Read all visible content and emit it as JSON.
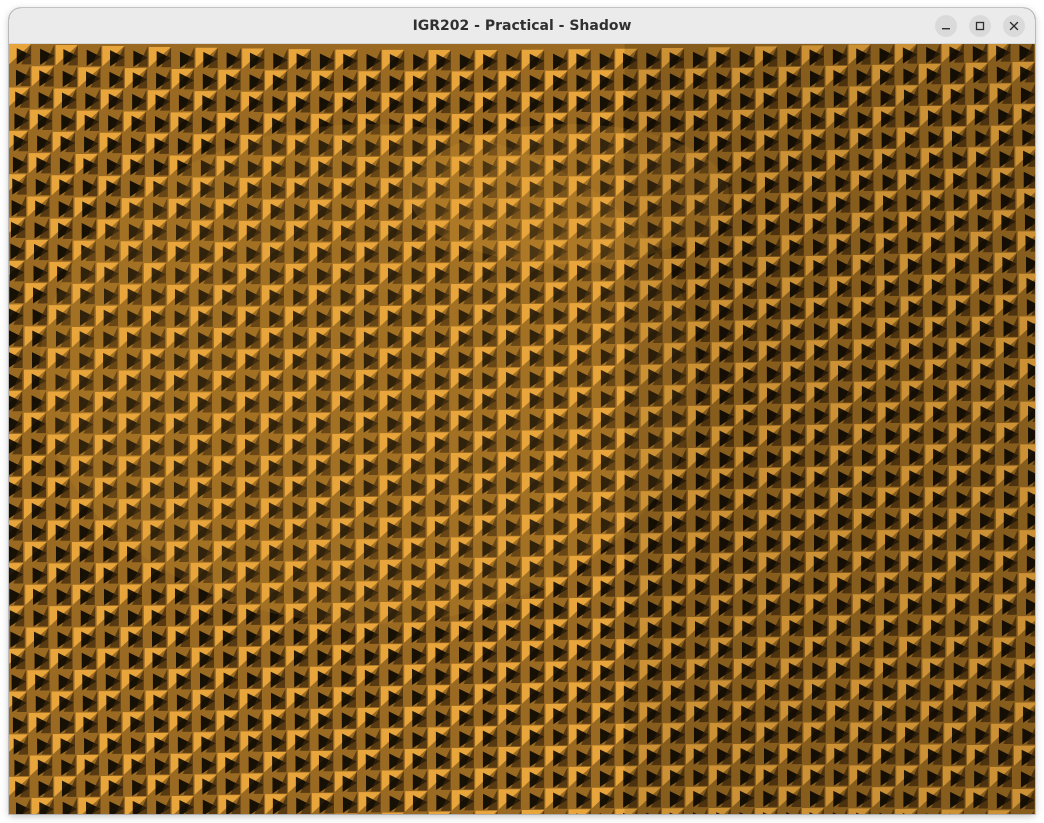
{
  "window": {
    "title": "IGR202 - Practical - Shadow"
  },
  "controls": {
    "minimize_icon": "minimize-icon",
    "maximize_icon": "maximize-icon",
    "close_icon": "close-icon"
  },
  "render": {
    "surface_color": "#e8a53c",
    "mid_color": "#9a6a22",
    "dark_color": "#3a260c",
    "shadow_color": "#000000"
  }
}
